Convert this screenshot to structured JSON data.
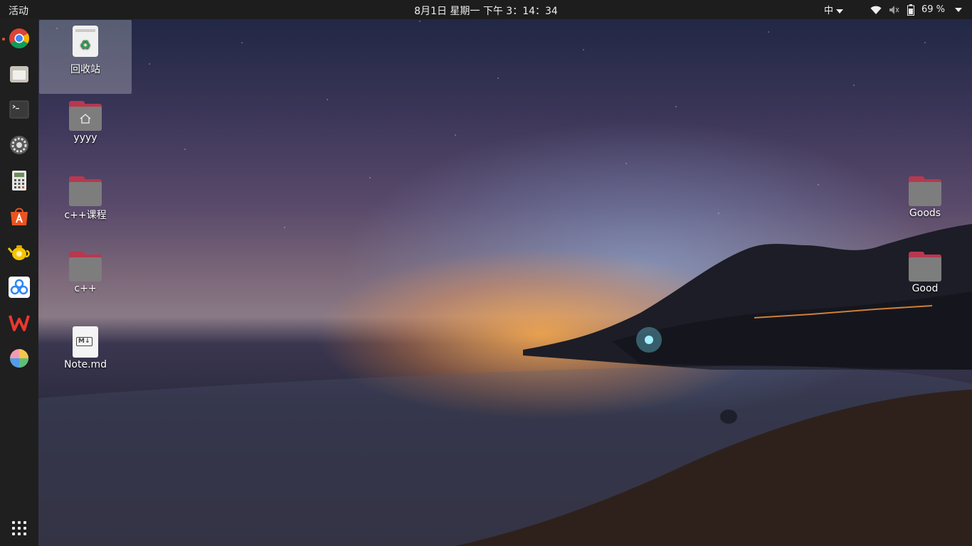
{
  "topbar": {
    "activities": "活动",
    "clock": "8月1日 星期一  下午 3：14：34",
    "input_method": "中",
    "battery": "69 %"
  },
  "dock": {
    "items": [
      {
        "icon": "chrome-icon",
        "color": "#db4437",
        "running": true
      },
      {
        "icon": "files-icon",
        "color": "#c8c3ba"
      },
      {
        "icon": "terminal-icon",
        "color": "#3a3a3a"
      },
      {
        "icon": "settings-icon",
        "color": "#9a9a9a"
      },
      {
        "icon": "calculator-icon",
        "color": "#e8e8e8"
      },
      {
        "icon": "software-center-icon",
        "color": "#e95420"
      },
      {
        "icon": "teapot-icon",
        "color": "#f5c400"
      },
      {
        "icon": "baidu-netdisk-icon",
        "color": "#2f86f6"
      },
      {
        "icon": "wps-icon",
        "color": "#e8382f"
      },
      {
        "icon": "color-picker-icon",
        "color": "#f39bb1"
      }
    ]
  },
  "desktop": {
    "icons": [
      {
        "label": "回收站",
        "type": "trash",
        "selected": true
      },
      {
        "label": "yyyy",
        "type": "home-folder"
      },
      {
        "label": "c++课程",
        "type": "folder"
      },
      {
        "label": "c++",
        "type": "folder"
      },
      {
        "label": "Note.md",
        "type": "markdown"
      },
      {
        "label": "Goods",
        "type": "folder"
      },
      {
        "label": "Good",
        "type": "folder"
      }
    ],
    "markdown_badge": "M↓"
  }
}
